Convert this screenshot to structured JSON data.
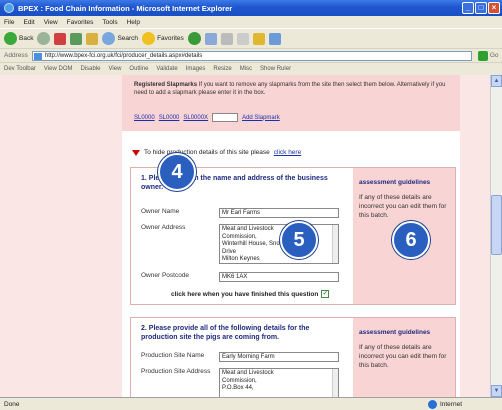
{
  "window": {
    "title": "BPEX : Food Chain Information - Microsoft Internet Explorer"
  },
  "menu": [
    "File",
    "Edit",
    "View",
    "Favorites",
    "Tools",
    "Help"
  ],
  "toolbar": {
    "back": "Back",
    "search": "Search",
    "favorites": "Favorites"
  },
  "address": {
    "label": "Address",
    "url": "http://www.bpex-fci.org.uk/fci/producer_details.aspx#details",
    "go": "Go"
  },
  "devtoolbar": [
    "Dev Toolbar",
    "View DOM",
    "Disable",
    "View",
    "Outline",
    "Validate",
    "Images",
    "Resize",
    "Misc",
    "Show Ruler"
  ],
  "slapmarks": {
    "title": "Registered Slapmarks",
    "text": "If you want to remove any slapmarks from the site then select them below. Alternatively if you need to add a slapmark please enter it in the box.",
    "links": [
      "SL0000",
      "SL0000",
      "SL0000X"
    ],
    "add_label": "Add Slapmark"
  },
  "hide_line": {
    "text": "To hide production details of this site please",
    "link": "click here"
  },
  "section1": {
    "title": "1. Please confirm the name and address of the business owner.",
    "owner_name_label": "Owner Name",
    "owner_name_value": "Mr Earl Farms",
    "owner_address_label": "Owner Address",
    "owner_address_lines": [
      "Meat and Livestock",
      "Commission,",
      "Winterhill House, Snowdon",
      "Drive",
      "Milton Keynes"
    ],
    "owner_postcode_label": "Owner Postcode",
    "owner_postcode_value": "MK6 1AX",
    "finished_text": "click here when you have finished this question",
    "guide_title": "assessment guidelines",
    "guide_text": "If any of these details are incorrect you can edit them for this batch."
  },
  "section2": {
    "title": "2. Please provide all of the following details for the production site the pigs are coming from.",
    "site_name_label": "Production Site Name",
    "site_name_value": "Early Morning Farm",
    "site_address_label": "Production Site Address",
    "site_address_lines": [
      "Meat and Livestock",
      "Commission,",
      "P.O.Box 44,"
    ],
    "guide_title": "assessment guidelines",
    "guide_text": "If any of these details are incorrect you can edit them for this batch."
  },
  "badges": [
    "4",
    "5",
    "6"
  ],
  "status": {
    "left": "Done",
    "zone": "Internet"
  }
}
